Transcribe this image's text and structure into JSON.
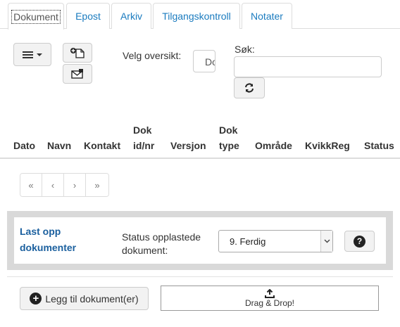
{
  "tabs": [
    {
      "label": "Dokument",
      "active": true
    },
    {
      "label": "Epost"
    },
    {
      "label": "Arkiv"
    },
    {
      "label": "Tilgangskontroll"
    },
    {
      "label": "Notater"
    }
  ],
  "toolbar": {
    "menu_icon": "bars-icon",
    "new_doc_icon": "new-document-icon",
    "email_icon": "envelope-icon",
    "overview_label": "Velg oversikt:",
    "overview_value": "Do",
    "search_label": "Søk:",
    "search_value": "",
    "refresh_icon": "refresh-icon"
  },
  "table": {
    "headers": [
      "Dato",
      "Navn",
      "Kontakt",
      "Dok id/nr",
      "Versjon",
      "Dok type",
      "Område",
      "KvikkReg",
      "Status"
    ],
    "header_lines": {
      "dok_id_1": "Dok",
      "dok_id_2": "id/nr",
      "dok_type_1": "Dok",
      "dok_type_2": "type"
    }
  },
  "pagination": {
    "first": "«",
    "prev": "‹",
    "next": "›",
    "last": "»"
  },
  "upload": {
    "title_line1": "Last opp",
    "title_line2": "dokumenter",
    "status_label_line1": "Status opplastede",
    "status_label_line2": "dokument:",
    "status_value": "9. Ferdig",
    "help_glyph": "?",
    "add_button": "Legg til dokument(er)",
    "drop_text": "Drag & Drop!",
    "drop_icon": "upload-icon"
  },
  "colors": {
    "link": "#1a7bbf",
    "title": "#1a5f9e",
    "panel_border": "#d9d9d9"
  }
}
